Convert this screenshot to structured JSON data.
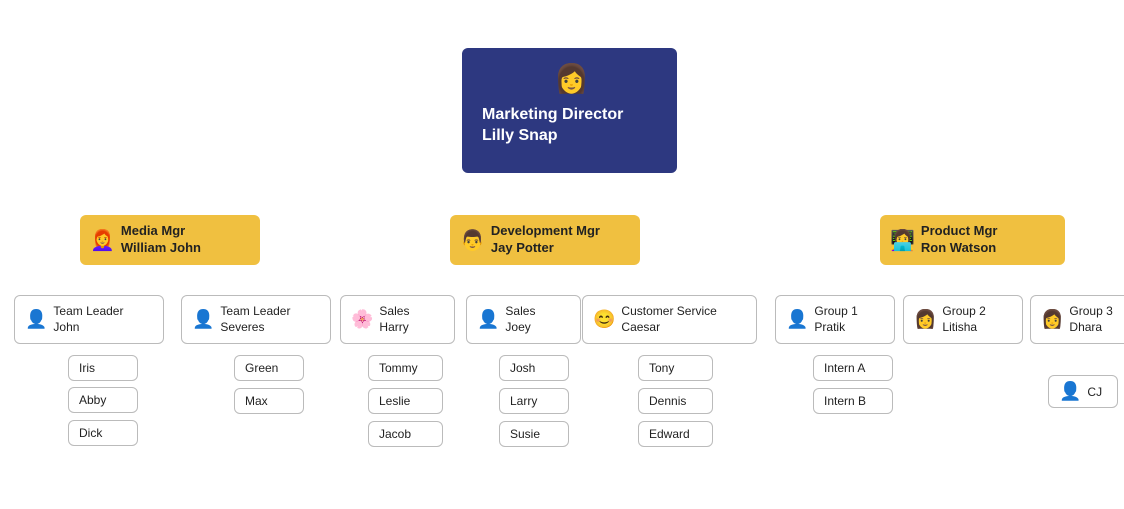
{
  "nodes": {
    "root": {
      "label": "Marketing Director\nLilly Snap",
      "avatar": "👩",
      "type": "root"
    },
    "media_mgr": {
      "label": "Media Mgr\nWilliam John",
      "avatar": "👩‍🦰",
      "type": "mgr"
    },
    "dev_mgr": {
      "label": "Development Mgr\nJay Potter",
      "avatar": "👨",
      "type": "mgr"
    },
    "product_mgr": {
      "label": "Product Mgr\nRon Watson",
      "avatar": "👩‍💻",
      "type": "mgr"
    },
    "tl_john": {
      "label": "Team Leader\nJohn",
      "avatar": "👤",
      "type": "lead"
    },
    "tl_severes": {
      "label": "Team Leader\nSeveres",
      "avatar": "👤",
      "type": "lead"
    },
    "sales_harry": {
      "label": "Sales\nHarry",
      "avatar": "🌸",
      "type": "lead"
    },
    "sales_joey": {
      "label": "Sales\nJoey",
      "avatar": "👤",
      "type": "lead"
    },
    "cs_caesar": {
      "label": "Customer Service\nCaesar",
      "avatar": "😊",
      "type": "lead"
    },
    "group1_pratik": {
      "label": "Group 1\nPratik",
      "avatar": "👤",
      "type": "lead"
    },
    "group2_litisha": {
      "label": "Group 2\nLitisha",
      "avatar": "👩",
      "type": "lead"
    },
    "group3_dhara": {
      "label": "Group 3\nDhara",
      "avatar": "👩",
      "type": "lead"
    },
    "iris": "Iris",
    "abby": "Abby",
    "dick": "Dick",
    "green": "Green",
    "max": "Max",
    "tommy": "Tommy",
    "leslie": "Leslie",
    "jacob": "Jacob",
    "josh": "Josh",
    "larry": "Larry",
    "susie": "Susie",
    "tony": "Tony",
    "dennis": "Dennis",
    "edward": "Edward",
    "intern_a": "Intern A",
    "intern_b": "Intern B",
    "cj": "CJ"
  }
}
